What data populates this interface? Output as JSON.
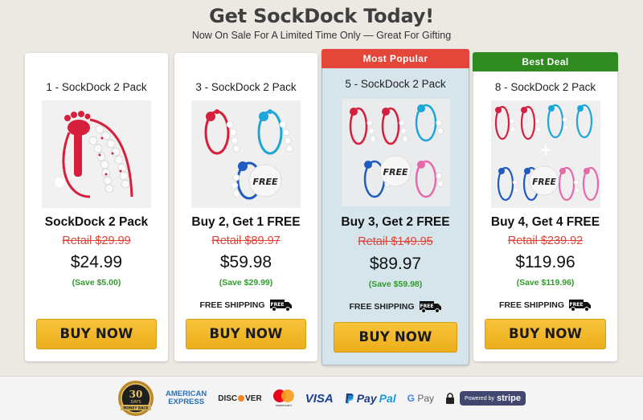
{
  "header": {
    "title": "Get SockDock Today!",
    "subtitle": "Now On Sale For A Limited Time Only — Great For Gifting"
  },
  "cards": [
    {
      "ribbon": "",
      "pack_title": "1 - SockDock 2 Pack",
      "image_free_label": "",
      "deal_title": "SockDock 2 Pack",
      "retail": "Retail $29.99",
      "price": "$24.99",
      "save": "(Save $5.00)",
      "shipping": "",
      "buy_label": "BUY NOW"
    },
    {
      "ribbon": "",
      "pack_title": "3 - SockDock 2 Pack",
      "image_free_label": "FREE",
      "deal_title": "Buy 2, Get 1 FREE",
      "retail": "Retail $89.97",
      "price": "$59.98",
      "save": "(Save $29.99)",
      "shipping": "FREE SHIPPING",
      "truck_text": "FREE",
      "buy_label": "BUY NOW"
    },
    {
      "ribbon": "Most Popular",
      "pack_title": "5 - SockDock 2 Pack",
      "image_free_label": "FREE",
      "deal_title": "Buy 3, Get 2 FREE",
      "retail": "Retail $149.95",
      "price": "$89.97",
      "save": "(Save $59.98)",
      "shipping": "FREE SHIPPING",
      "truck_text": "FREE",
      "buy_label": "BUY NOW"
    },
    {
      "ribbon": "Best Deal",
      "pack_title": "8 - SockDock 2 Pack",
      "image_free_label": "FREE",
      "deal_title": "Buy 4, Get 4 FREE",
      "retail": "Retail $239.92",
      "price": "$119.96",
      "save": "(Save $119.96)",
      "shipping": "FREE SHIPPING",
      "truck_text": "FREE",
      "buy_label": "BUY NOW"
    }
  ],
  "footer": {
    "guarantee_days": "30",
    "guarantee_label": "DAYS",
    "guarantee_sub": "MONEY BACK",
    "amex_line1": "AMERICAN",
    "amex_line2": "EXPRESS",
    "discover_left": "DISC",
    "discover_right": "VER",
    "mastercard_text": "mastercard",
    "visa": "VISA",
    "paypal_left": "Pay",
    "paypal_right": "Pal",
    "gpay_g": "G",
    "gpay_text": "Pay",
    "stripe_powered": "Powered by",
    "stripe_name": "stripe"
  },
  "colors": {
    "page_bg": "#ece9e3",
    "ribbon_popular": "#e5463a",
    "ribbon_best": "#2f8a1f",
    "retail_red": "#e04236",
    "save_green": "#2f9a2c",
    "buy_button": "#f2b72a",
    "sockdock_red": "#d51f3c",
    "sockdock_cyan": "#1ea6d8",
    "sockdock_blue": "#1f5bc0",
    "sockdock_pink": "#e56aa9"
  },
  "icons": {
    "shipping": "truck-icon",
    "secure": "lock-icon",
    "guarantee": "guarantee-seal-icon"
  }
}
